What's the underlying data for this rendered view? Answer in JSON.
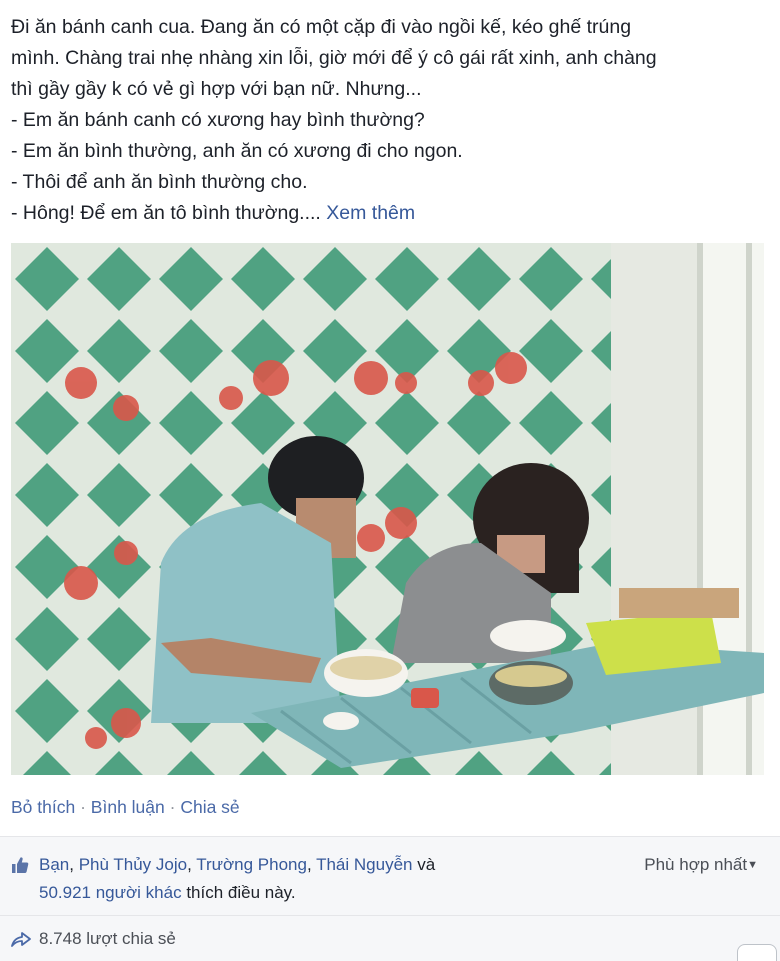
{
  "post": {
    "lines": [
      "Đi ăn bánh canh cua. Đang ăn có một cặp đi vào ngồi kế, kéo ghế trúng",
      "mình. Chàng trai nhẹ nhàng xin lỗi, giờ mới để ý cô gái rất xinh, anh chàng",
      "thì gầy gầy k có vẻ gì hợp với bạn nữ. Nhưng...",
      "- Em ăn bánh canh có xương hay bình thường?",
      "- Em ăn bình thường, anh ăn có xương đi cho ngon.",
      "- Thôi để anh ăn bình thường cho.",
      "- Hông! Để em ăn tô bình thường...."
    ],
    "see_more": "Xem thêm"
  },
  "actions": {
    "like": "Bỏ thích",
    "comment": "Bình luận",
    "share": "Chia sẻ",
    "separator": "·"
  },
  "feedback": {
    "likers": [
      "Bạn",
      "Phù Thủy Jojo",
      "Trường Phong",
      "Thái Nguyễn"
    ],
    "and": "và",
    "others_count": "50.921 người khác",
    "likes_suffix": "thích điều này.",
    "sort_label": "Phù hợp nhất",
    "shares": "8.748 lượt chia sẻ"
  },
  "icons": {
    "like": "thumbs-up-icon",
    "share": "share-arrow-icon",
    "sort": "caret-down-icon"
  },
  "colors": {
    "link": "#365899",
    "text": "#1d2129",
    "muted": "#4b4f56",
    "feedback_bg": "#f6f7f9",
    "tile_green": "#3f9a78"
  }
}
